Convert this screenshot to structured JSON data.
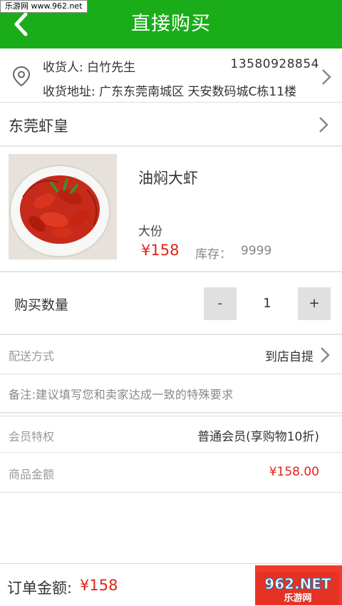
{
  "watermark_top": "乐游网 www.962.net",
  "header": {
    "title": "直接购买",
    "back_icon": "chevron-left-icon"
  },
  "address": {
    "icon": "location-pin-icon",
    "receiver_label": "收货人:",
    "receiver_name": "白竹先生",
    "phone": "13580928854",
    "address_label": "收货地址:",
    "address_value": "广东东莞南城区 天安数码城C栋11楼"
  },
  "shop": {
    "name": "东莞虾皇"
  },
  "product": {
    "name": "油焖大虾",
    "spec": "大份",
    "price": "¥158",
    "stock_label": "库存：",
    "stock_value": "9999"
  },
  "quantity": {
    "label": "购买数量",
    "minus": "-",
    "value": "1",
    "plus": "+"
  },
  "delivery": {
    "label": "配送方式",
    "value": "到店自提"
  },
  "remark": {
    "placeholder": "备注:建议填写您和卖家达成一致的特殊要求"
  },
  "member": {
    "label": "会员特权",
    "value": "普通会员(享购物10折)"
  },
  "amount": {
    "label": "商品金额",
    "value": "¥158.00"
  },
  "footer": {
    "total_label": "订单金额:",
    "total_value": "¥158"
  },
  "watermark_bottom": "962.NET 乐游网",
  "colors": {
    "header_green": "#1aad19",
    "price_red": "#e2231a",
    "submit_red": "#f23a2c"
  }
}
